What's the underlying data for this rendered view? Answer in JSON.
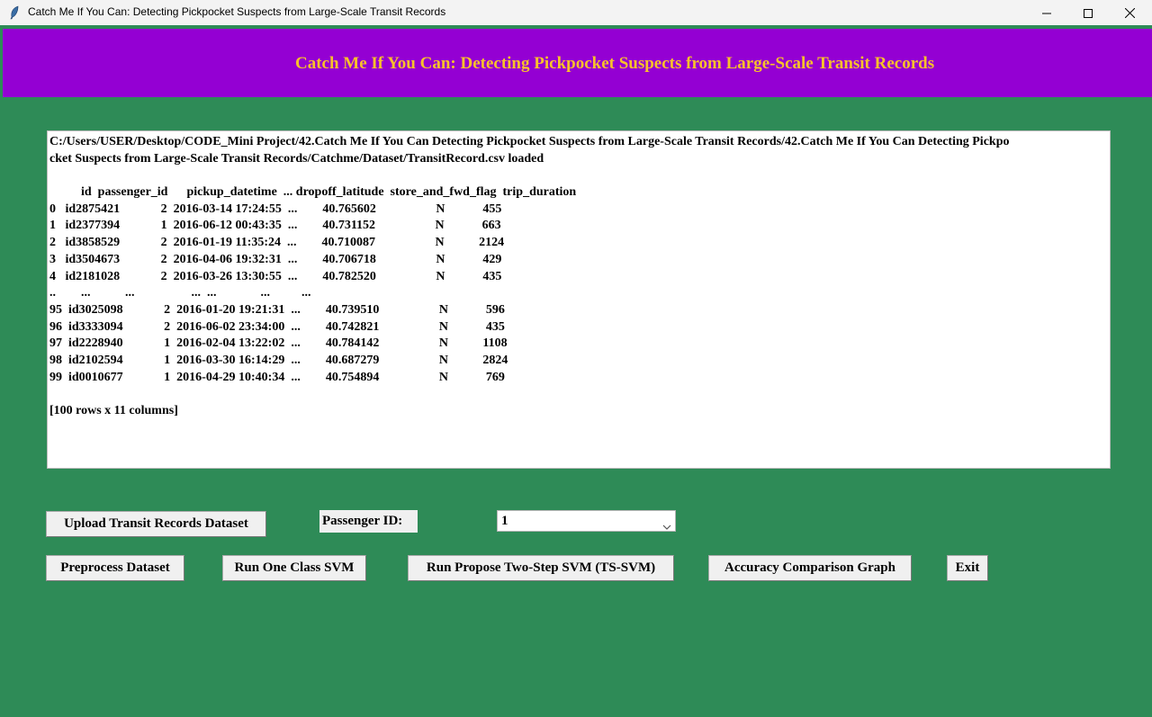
{
  "window": {
    "title": "Catch Me If You Can: Detecting Pickpocket Suspects from Large-Scale Transit Records"
  },
  "header": {
    "title": "Catch Me If You Can: Detecting Pickpocket Suspects from Large-Scale Transit Records"
  },
  "output": {
    "lines": [
      "C:/Users/USER/Desktop/CODE_Mini Project/42.Catch Me If You Can Detecting Pickpocket Suspects from Large-Scale Transit Records/42.Catch Me If You Can Detecting Pickpo",
      "cket Suspects from Large-Scale Transit Records/Catchme/Dataset/TransitRecord.csv loaded",
      "",
      "          id  passenger_id      pickup_datetime  ... dropoff_latitude  store_and_fwd_flag  trip_duration",
      "0   id2875421             2  2016-03-14 17:24:55  ...        40.765602                   N            455",
      "1   id2377394             1  2016-06-12 00:43:35  ...        40.731152                   N            663",
      "2   id3858529             2  2016-01-19 11:35:24  ...        40.710087                   N           2124",
      "3   id3504673             2  2016-04-06 19:32:31  ...        40.706718                   N            429",
      "4   id2181028             2  2016-03-26 13:30:55  ...        40.782520                   N            435",
      "..        ...           ...                  ...  ...              ...          ...",
      "95  id3025098             2  2016-01-20 19:21:31  ...        40.739510                   N            596",
      "96  id3333094             2  2016-06-02 23:34:00  ...        40.742821                   N            435",
      "97  id2228940             1  2016-02-04 13:22:02  ...        40.784142                   N           1108",
      "98  id2102594             1  2016-03-30 16:14:29  ...        40.687279                   N           2824",
      "99  id0010677             1  2016-04-29 10:40:34  ...        40.754894                   N            769",
      "",
      "[100 rows x 11 columns]"
    ]
  },
  "controls": {
    "upload_label": "Upload Transit Records Dataset",
    "passenger_label": "Passenger ID:",
    "passenger_value": "1",
    "preprocess_label": "Preprocess Dataset",
    "one_class_svm_label": "Run One Class SVM",
    "ts_svm_label": "Run Propose Two-Step SVM (TS-SVM)",
    "graph_label": "Accuracy Comparison Graph",
    "exit_label": "Exit"
  },
  "colors": {
    "background": "#2e8b57",
    "header_bg": "#9400d3",
    "header_text": "#f7c12b"
  },
  "icons": {
    "app": "feather-icon",
    "minimize": "minimize-icon",
    "maximize": "maximize-icon",
    "close": "close-icon",
    "dropdown": "chevron-down-icon"
  }
}
